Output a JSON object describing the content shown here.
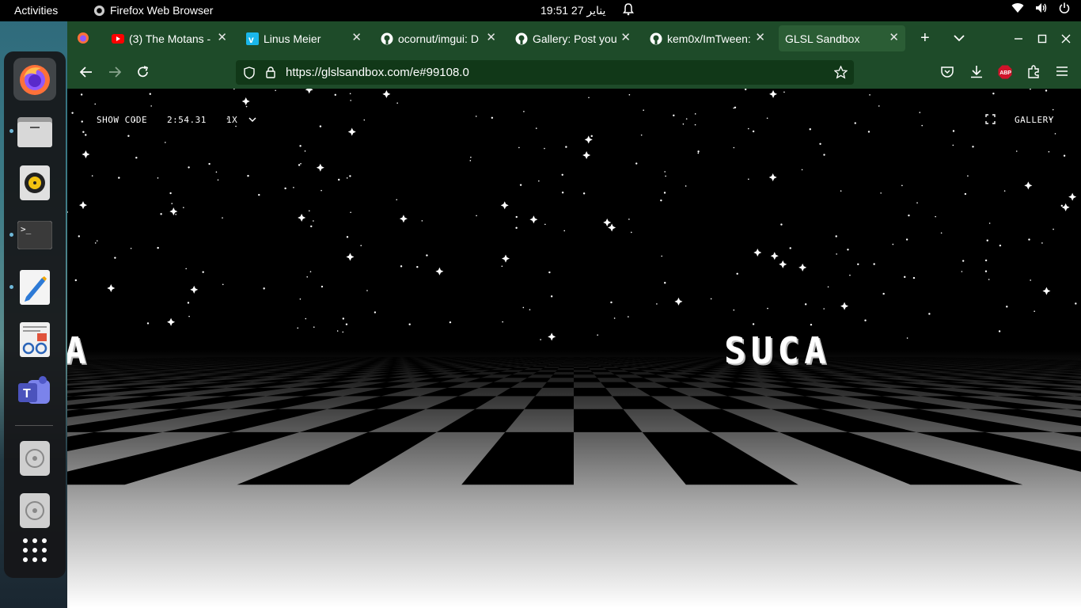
{
  "topbar": {
    "activities": "Activities",
    "app_name": "Firefox Web Browser",
    "clock": "19:51  27 يناير"
  },
  "dock": {
    "items": [
      "firefox-icon",
      "files-icon",
      "rhythmbox-icon",
      "terminal-icon",
      "text-editor-icon",
      "document-viewer-icon",
      "teams-icon",
      "disc-icon",
      "disc-icon",
      "app-grid-icon"
    ]
  },
  "tabs": [
    {
      "label": "(3) The Motans -",
      "icon": "youtube-icon"
    },
    {
      "label": "Linus Meier",
      "icon": "vimeo-icon"
    },
    {
      "label": "ocornut/imgui: D",
      "icon": "github-icon"
    },
    {
      "label": "Gallery: Post you",
      "icon": "github-icon"
    },
    {
      "label": "kem0x/ImTween:",
      "icon": "github-icon"
    },
    {
      "label": "GLSL Sandbox",
      "icon": ""
    }
  ],
  "nav": {
    "url": "https://glslsandbox.com/e#99108.0"
  },
  "glsl": {
    "show_code": "SHOW CODE",
    "time": "2:54.31",
    "speed": "1X",
    "gallery": "GALLERY",
    "scroller_text": "SUCA",
    "scroller_left": "A"
  },
  "colors": {
    "tab_bar": "#1e4b29",
    "url_bar": "#113818",
    "dock": "#161618",
    "abp_badge": "#d1132a"
  }
}
